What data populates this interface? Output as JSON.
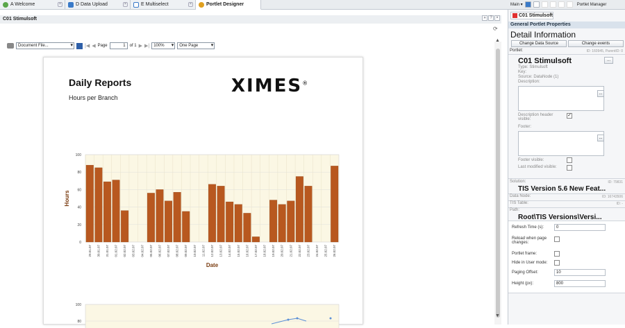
{
  "tabs": [
    {
      "label": "A Welcome",
      "icon": "welcome-icon",
      "color": "#5aa64a"
    },
    {
      "label": "D Data Upload",
      "icon": "data-upload-icon",
      "color": "#3a7ac8"
    },
    {
      "label": "E Multiselect",
      "icon": "multiselect-icon",
      "color": "#3a7ac8"
    },
    {
      "label": "Portlet Designer",
      "icon": "portlet-designer-icon",
      "color": "#e0a020"
    }
  ],
  "topright": {
    "main_label": "Main ▾",
    "manager_label": "Portlet Manager"
  },
  "main_header": {
    "title": "C01 Stimulsoft",
    "ctrl_expand": "»",
    "ctrl_help": "?",
    "ctrl_close": "×"
  },
  "viewer": {
    "document_select": "Document File...",
    "page_label": "Page",
    "page_value": "1",
    "of_label": "of 1",
    "zoom": "100%",
    "view_mode": "One Page"
  },
  "report": {
    "title": "Daily Reports",
    "subtitle": "Hours per Branch",
    "logo_text": "XIMES",
    "logo_mark": "®"
  },
  "chart_data": [
    {
      "type": "bar",
      "xlabel": "Date",
      "ylabel": "Hours",
      "ylim": [
        0,
        100
      ],
      "yticks": [
        0,
        20,
        40,
        60,
        80,
        100
      ],
      "categories": [
        "29.01.07",
        "30.01.07",
        "31.01.07",
        "01.02.07",
        "02.02.07",
        "03.02.07",
        "04.02.07",
        "05.02.07",
        "06.02.07",
        "07.02.07",
        "08.02.07",
        "09.02.07",
        "10.02.07",
        "11.02.07",
        "12.02.07",
        "13.02.07",
        "14.02.07",
        "15.02.07",
        "16.02.07",
        "17.02.07",
        "18.02.07",
        "19.02.07",
        "20.02.07",
        "21.02.07",
        "22.02.07",
        "23.02.07",
        "24.02.07",
        "25.02.07",
        "26.02.07"
      ],
      "values": [
        88,
        85,
        69,
        71,
        36,
        0,
        0,
        56,
        60,
        47,
        57,
        35,
        0,
        0,
        66,
        64,
        46,
        43,
        33,
        6,
        0,
        48,
        43,
        47,
        75,
        64,
        0,
        0,
        87
      ],
      "bar_color": "#b8581f",
      "grid": true
    },
    {
      "type": "line",
      "ylim": [
        0,
        100
      ],
      "yticks": [
        80,
        100
      ],
      "note_visible": "partially visible below"
    }
  ],
  "rightpanel": {
    "tab": "C01 Stimulsoft",
    "section": "General Portlet Properties",
    "detail_title": "Detail Information",
    "change_source": "Change Data Source",
    "change_events": "Change events",
    "portlet_label": "Portlet:",
    "portlet_id": "ID: 160945, ParentID: 0",
    "portlet_name": "C01 Stimulsoft",
    "type": "Type: Stimulsoft",
    "key": "Key:",
    "source": "Source: DataNode (1)",
    "description": "Description:",
    "desc_header_visible": "Description header visible:",
    "footer": "Footer:",
    "footer_visible": "Footer visible:",
    "last_modified_visible": "Last modified visible:",
    "solution_label": "Solution:",
    "solution_id": "ID: 79831",
    "solution_name": "TIS Version 5.6 New Feat...",
    "datanode_label": "Data Node:",
    "datanode_id": "ID: 16743506",
    "tistable_label": "TIS Table:",
    "tistable_id": "ID: -",
    "path_label": "Path:",
    "path_value": "Root\\TIS Versions\\Versi...",
    "refresh_label": "Refresh Time (s):",
    "refresh_value": "0",
    "reload_label": "Reload when page changes:",
    "frame_label": "Portlet frame:",
    "hide_label": "Hide in User mode:",
    "paging_label": "Paging Offset:",
    "paging_value": "10",
    "height_label": "Height (px):",
    "height_value": "800"
  }
}
